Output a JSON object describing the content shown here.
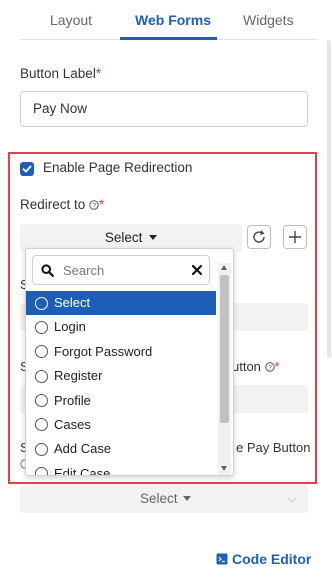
{
  "tabs": {
    "layout": "Layout",
    "web_forms": "Web Forms",
    "widgets": "Widgets",
    "active": "Web Forms"
  },
  "button_label": {
    "label": "Button Label",
    "required_mark": "*",
    "value": "Pay Now"
  },
  "redirection": {
    "checkbox_label": "Enable Page Redirection",
    "checked": true,
    "redirect_label": "Redirect to",
    "required_mark": "*",
    "select_label": "Select",
    "dropdown": {
      "search_placeholder": "Search",
      "options": [
        "Select",
        "Login",
        "Forgot Password",
        "Register",
        "Profile",
        "Cases",
        "Add Case",
        "Edit Case"
      ],
      "selected": "Select"
    }
  },
  "hidden_fields": {
    "field1_initial": "S",
    "field2_initial": "S",
    "field2_suffix": "utton",
    "field2_required": "*",
    "field3_initial": "S",
    "field3_suffix": "e Pay Button",
    "bottom_select_label": "Select"
  },
  "footer": {
    "code_editor_label": "Code Editor"
  },
  "colors": {
    "accent": "#1d5fb8",
    "required": "#d9363e",
    "highlight_frame": "#e0424a"
  }
}
